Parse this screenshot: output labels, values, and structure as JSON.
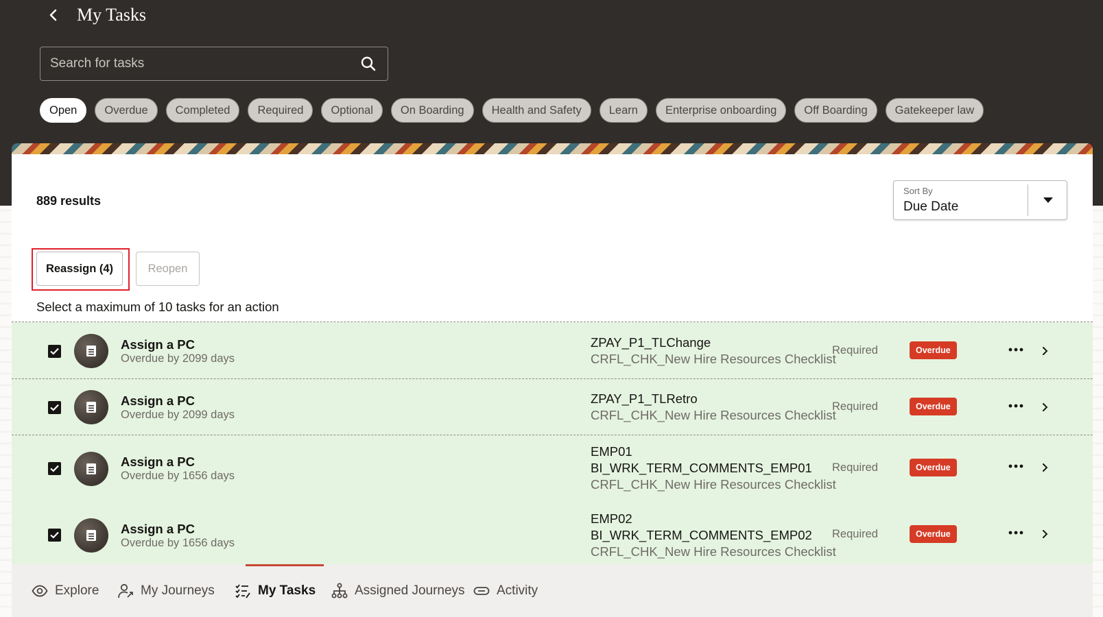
{
  "header": {
    "title": "My Tasks",
    "back_icon": "chevron-left-icon"
  },
  "search": {
    "placeholder": "Search for tasks",
    "value": "",
    "icon": "search-icon"
  },
  "filters": [
    {
      "label": "Open",
      "active": true
    },
    {
      "label": "Overdue",
      "active": false
    },
    {
      "label": "Completed",
      "active": false
    },
    {
      "label": "Required",
      "active": false
    },
    {
      "label": "Optional",
      "active": false
    },
    {
      "label": "On Boarding",
      "active": false
    },
    {
      "label": "Health and Safety",
      "active": false
    },
    {
      "label": "Learn",
      "active": false
    },
    {
      "label": "Enterprise onboarding",
      "active": false
    },
    {
      "label": "Off Boarding",
      "active": false
    },
    {
      "label": "Gatekeeper law",
      "active": false
    }
  ],
  "results": {
    "count_label": "889 results"
  },
  "sort": {
    "label": "Sort By",
    "value": "Due Date"
  },
  "actions": {
    "reassign_label": "Reassign (4)",
    "reopen_label": "Reopen",
    "hint": "Select a maximum of 10 tasks for an action"
  },
  "tasks": [
    {
      "checked": true,
      "title": "Assign a PC",
      "subtitle": "Overdue by 2099 days",
      "line1": "ZPAY_P1_TLChange",
      "line2": "",
      "checklist": "CRFL_CHK_New Hire Resources Checklist",
      "requirement": "Required",
      "status": "Overdue"
    },
    {
      "checked": true,
      "title": "Assign a PC",
      "subtitle": "Overdue by 2099 days",
      "line1": "ZPAY_P1_TLRetro",
      "line2": "",
      "checklist": "CRFL_CHK_New Hire Resources Checklist",
      "requirement": "Required",
      "status": "Overdue"
    },
    {
      "checked": true,
      "title": "Assign a PC",
      "subtitle": "Overdue by 1656 days",
      "line1": "EMP01",
      "line2": "BI_WRK_TERM_COMMENTS_EMP01",
      "checklist": "CRFL_CHK_New Hire Resources Checklist",
      "requirement": "Required",
      "status": "Overdue"
    },
    {
      "checked": true,
      "title": "Assign a PC",
      "subtitle": "Overdue by 1656 days",
      "line1": "EMP02",
      "line2": "BI_WRK_TERM_COMMENTS_EMP02",
      "checklist": "CRFL_CHK_New Hire Resources Checklist",
      "requirement": "Required",
      "status": "Overdue"
    }
  ],
  "bottom_nav": [
    {
      "label": "Explore",
      "icon": "eye-icon",
      "active": false
    },
    {
      "label": "My Journeys",
      "icon": "user-journey-icon",
      "active": false
    },
    {
      "label": "My Tasks",
      "icon": "task-list-icon",
      "active": true
    },
    {
      "label": "Assigned Journeys",
      "icon": "hierarchy-icon",
      "active": false
    },
    {
      "label": "Activity",
      "icon": "link-icon",
      "active": false
    }
  ],
  "colors": {
    "header_bg": "#312d2a",
    "row_bg": "#e5f4e0",
    "overdue_badge": "#d63b25",
    "highlight_outline": "#e0202a",
    "active_nav_bar": "#c74634"
  }
}
